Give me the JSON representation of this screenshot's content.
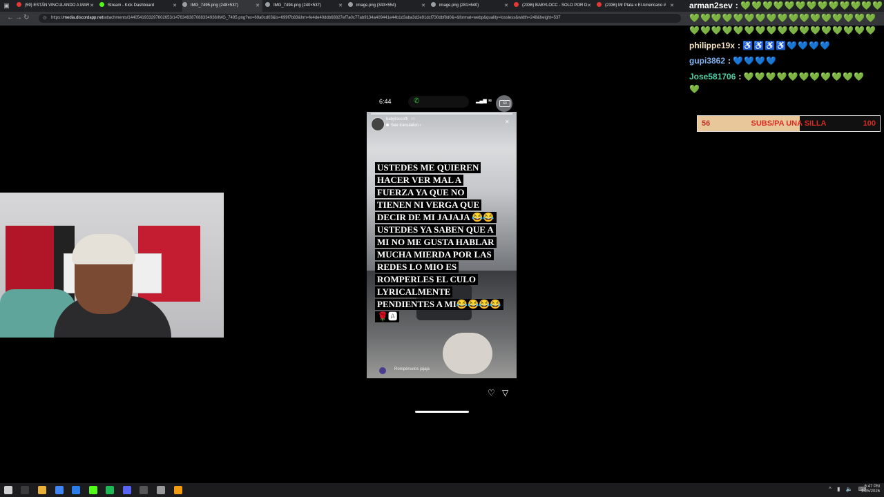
{
  "browser": {
    "tabs": [
      {
        "label": "(59) ESTÁN VINCULANDO A MAR",
        "icon": "youtube-icon",
        "color": "#e53935",
        "active": false
      },
      {
        "label": "Stream - Kick Dashboard",
        "icon": "kick-icon",
        "color": "#53fc18",
        "active": false
      },
      {
        "label": "IMG_7495.png (248×537)",
        "icon": "globe-icon",
        "color": "#9aa0a6",
        "active": true
      },
      {
        "label": "IMG_7494.png (240×537)",
        "icon": "globe-icon",
        "color": "#9aa0a6",
        "active": false
      },
      {
        "label": "image.png (343×554)",
        "icon": "globe-icon",
        "color": "#9aa0a6",
        "active": false
      },
      {
        "label": "image.png (281×640)",
        "icon": "globe-icon",
        "color": "#9aa0a6",
        "active": false
      },
      {
        "label": "(2336) BABYLOCC - SOLO POR D",
        "icon": "youtube-icon",
        "color": "#e53935",
        "active": false
      },
      {
        "label": "(2336) Mr Plata x El Americano #",
        "icon": "youtube-icon",
        "color": "#e53935",
        "active": false
      }
    ],
    "url_host": "media.discordapp.net",
    "url_prefix": "https://",
    "url_rest": "/attachments/1440541933297602653/1476349387088334938/IMG_7495.png?ex=69a0cd03&is=699f7b83&hm=fe4de40ddb68827ef7a0c77ab9134a409441e44b1d3aba3d2e91dcf730dbf8d0&=&format=webp&quality=lossless&width=248&height=537"
  },
  "story": {
    "status_time": "6:44",
    "battery": "60",
    "username": "babyloccoffi",
    "age": "4h",
    "see_translation": "See translation",
    "caption_lines": [
      "USTEDES ME QUIEREN",
      "HACER VER MAL A",
      "FUERZA YA QUE NO",
      "TIENEN NI VERGA QUE",
      "DECIR DE MI JAJAJA 😂😂",
      "USTEDES YA SABEN QUE A",
      "MI NO ME GUSTA HABLAR",
      "MUCHA MIERDA POR LAS",
      "REDES LO MIO ES",
      "ROMPERLES EL CULO",
      "LYRICALMENTE",
      "PENDIENTES A MI😂😂😂😂",
      "🌹🅰"
    ],
    "reply_text": "Rompérselos jajaja"
  },
  "chat": {
    "messages": [
      {
        "user": "arman2sev",
        "color": "#ffffff",
        "content": "💚💚💚💚💚💚💚💚💚💚💚💚💚💚💚",
        "style": "green"
      },
      {
        "user": "",
        "color": "#ffffff",
        "content": "💚💚💚💚💚💚💚💚💚💚💚💚💚💚💚💚💚",
        "style": "green"
      },
      {
        "user": "",
        "color": "#ffffff",
        "content": "💚💚💚💚💚💚💚💚💚💚💚💚💚💚💚💚💚",
        "style": "green"
      },
      {
        "user": "philippe19x",
        "color": "#f5e3c3",
        "content": "♿♿♿♿💙💙💙💙",
        "style": "wheel"
      },
      {
        "user": "gupi3862",
        "color": "#7fb3f0",
        "content": "💙💙💙💙",
        "style": "blue"
      },
      {
        "user": "Jose581706",
        "color": "#4fd1a8",
        "content": "💚💚💚💚💚💚💚💚💚💚💚",
        "style": "green"
      },
      {
        "user": "",
        "color": "#ffffff",
        "content": "💚",
        "style": "green"
      }
    ]
  },
  "goal": {
    "current": "56",
    "label": "SUBS/PA UNA SILLA",
    "target": "100",
    "progress": 0.56
  },
  "taskbar": {
    "time": "6:47 PM",
    "date": "2/25/2026",
    "apps": [
      {
        "name": "windows-start-icon",
        "color": "#d0d0d0"
      },
      {
        "name": "search-icon",
        "color": "#3b3b3b"
      },
      {
        "name": "file-explorer-icon",
        "color": "#e8b23a"
      },
      {
        "name": "chrome-icon",
        "color": "#4285f4"
      },
      {
        "name": "store-icon",
        "color": "#2b7de9"
      },
      {
        "name": "kick-icon",
        "color": "#53fc18"
      },
      {
        "name": "spotify-icon",
        "color": "#1db954"
      },
      {
        "name": "discord-icon",
        "color": "#5865f2"
      },
      {
        "name": "obs-icon",
        "color": "#555555"
      },
      {
        "name": "shield-icon",
        "color": "#9a9a9a"
      },
      {
        "name": "app-icon",
        "color": "#f39c12"
      }
    ]
  }
}
